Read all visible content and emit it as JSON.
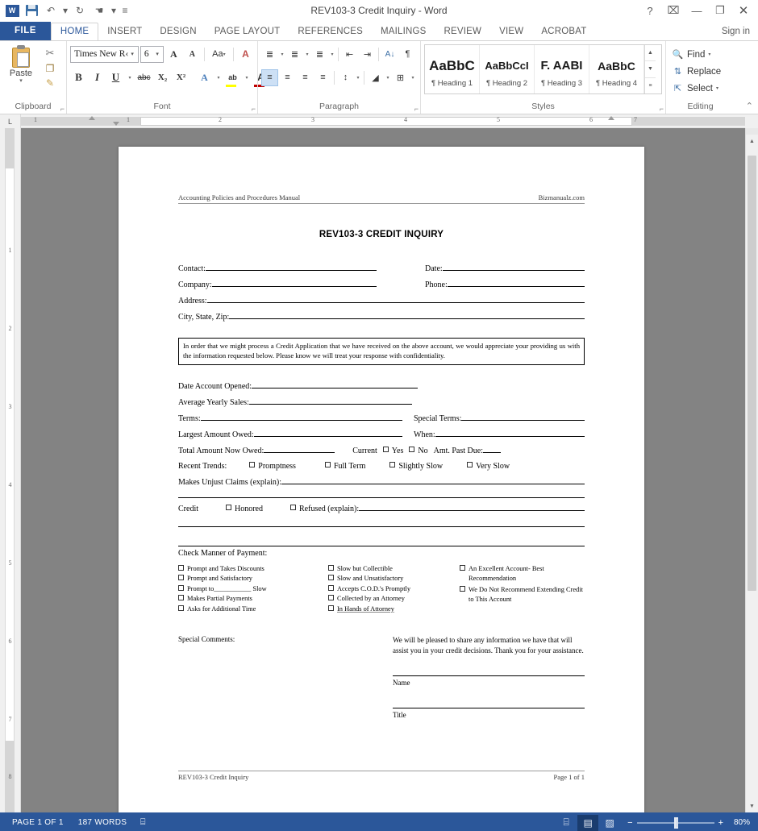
{
  "window": {
    "title": "REV103-3 Credit Inquiry - Word",
    "quick_access": [
      {
        "name": "word-logo",
        "label": "W"
      },
      {
        "name": "save",
        "label": "Save"
      },
      {
        "name": "undo",
        "label": "↶"
      },
      {
        "name": "undo-dropdown",
        "label": "▾"
      },
      {
        "name": "repeat",
        "label": "↻"
      },
      {
        "name": "touch-mode",
        "label": "☚"
      },
      {
        "name": "touch-dropdown",
        "label": "▾"
      },
      {
        "name": "customize-qat",
        "label": "≡"
      }
    ],
    "controls": {
      "help": "?",
      "ribbon_display": "⌧",
      "minimize": "—",
      "maximize": "❐",
      "close": "✕"
    }
  },
  "tabs": [
    {
      "label": "FILE",
      "active": false,
      "file": true
    },
    {
      "label": "HOME",
      "active": true,
      "file": false
    },
    {
      "label": "INSERT",
      "active": false,
      "file": false
    },
    {
      "label": "DESIGN",
      "active": false,
      "file": false
    },
    {
      "label": "PAGE LAYOUT",
      "active": false,
      "file": false
    },
    {
      "label": "REFERENCES",
      "active": false,
      "file": false
    },
    {
      "label": "MAILINGS",
      "active": false,
      "file": false
    },
    {
      "label": "REVIEW",
      "active": false,
      "file": false
    },
    {
      "label": "VIEW",
      "active": false,
      "file": false
    },
    {
      "label": "ACROBAT",
      "active": false,
      "file": false
    }
  ],
  "sign_in": "Sign in",
  "ribbon": {
    "clipboard": {
      "label": "Clipboard",
      "paste_label": "Paste",
      "paste_caret": "▾",
      "cut": "✂",
      "copy": "❐",
      "format_painter": "✎",
      "dialog_launcher": "⌐"
    },
    "font": {
      "label": "Font",
      "font_name": "Times New R‹",
      "font_size": "6",
      "grow_font": "A",
      "shrink_font": "A",
      "change_case": "Aa",
      "clear_formatting": "A",
      "bold": "B",
      "italic": "I",
      "underline": "U",
      "strikethrough": "abc",
      "subscript": "X₂",
      "superscript": "X²",
      "text_effects": "A",
      "highlight": "ab",
      "font_color": "A",
      "caret": "▾",
      "dialog_launcher": "⌐"
    },
    "paragraph": {
      "label": "Paragraph",
      "bullets": "≣",
      "numbering": "≣",
      "multilevel": "≣",
      "decrease_indent": "⇤",
      "increase_indent": "⇥",
      "sort": "A↓",
      "show_marks": "¶",
      "align_left": "≡",
      "align_center": "≡",
      "align_right": "≡",
      "justify": "≡",
      "line_spacing": "↕",
      "shading": "◢",
      "borders": "⊞",
      "caret": "▾",
      "dialog_launcher": "⌐"
    },
    "styles": {
      "label": "Styles",
      "items": [
        {
          "preview": "AaBbC",
          "name": "Heading 1"
        },
        {
          "preview": "AaBbCcI",
          "name": "Heading 2"
        },
        {
          "preview": "F. AABI",
          "name": "Heading 3"
        },
        {
          "preview": "AaBbC",
          "name": "Heading 4"
        }
      ],
      "scroll_up": "▲",
      "scroll_down": "▼",
      "more": "≡",
      "dialog_launcher": "⌐"
    },
    "editing": {
      "label": "Editing",
      "find": "Find",
      "replace": "Replace",
      "select": "Select",
      "caret": "▾"
    },
    "collapse_ribbon": "⌃"
  },
  "ruler": {
    "corner_marker": "L",
    "h_numbers": [
      "1",
      "1",
      "2",
      "3",
      "4",
      "5",
      "6",
      "7"
    ],
    "v_numbers": [
      "1",
      "2",
      "3",
      "4",
      "5",
      "6",
      "7",
      "8"
    ]
  },
  "document": {
    "header": {
      "left": "Accounting Policies and Procedures Manual",
      "right": "Bizmanualz.com"
    },
    "title": "REV103-3 CREDIT INQUIRY",
    "contact_fields": [
      {
        "left_label": "Contact:",
        "right_label": "Date:"
      },
      {
        "left_label": "Company:",
        "right_label": "Phone:"
      },
      {
        "left_label": "Address:",
        "right_label": ""
      },
      {
        "left_label": "City, State, Zip:",
        "right_label": ""
      }
    ],
    "notice": "In order that we might process a Credit Application that we have received on the above account, we would appreciate your providing us with the information requested below.  Please know we will treat your response with confidentiality.",
    "account_fields": [
      {
        "label": "Date Account Opened:",
        "line_width": 206
      },
      {
        "label": "Average Yearly Sales:",
        "line_width": 206
      }
    ],
    "terms_row": {
      "left_label": "Terms:",
      "right_label": "Special Terms:"
    },
    "owed_row": {
      "left_label": "Largest Amount Owed:",
      "right_label": "When:"
    },
    "total_row": {
      "label": "Total Amount Now Owed:",
      "current_label": "Current",
      "yes_label": "Yes",
      "no_label": "No",
      "past_due_label": "Amt. Past Due:"
    },
    "trends": {
      "label": "Recent Trends:",
      "options": [
        "Promptness",
        "Full Term",
        "Slightly Slow",
        "Very Slow"
      ]
    },
    "unjust_claims_label": "Makes Unjust Claims (explain):",
    "credit_row": {
      "label": "Credit",
      "honored": "Honored",
      "refused": "Refused (explain):"
    },
    "payment_heading": "Check Manner of Payment:",
    "payment_col1": [
      "Prompt and Takes Discounts",
      "Prompt and Satisfactory",
      "Prompt to___________ Slow",
      "Makes Partial Payments",
      "Asks for Additional Time"
    ],
    "payment_col2": [
      "Slow but Collectible",
      "Slow and Unsatisfactory",
      "Accepts C.O.D.'s Promptly",
      "Collected by an Attorney",
      "In Hands of Attorney"
    ],
    "payment_col3": [
      "An Excellent Account- Best Recommendation",
      "We Do Not Recommend Extending Credit to This Account"
    ],
    "special_comments_label": "Special Comments:",
    "closing_text": "We will be pleased to share any information we have that will assist you in your credit decisions.  Thank you for your assistance.",
    "signature_name_label": "Name",
    "signature_title_label": "Title",
    "footer": {
      "left": "REV103-3 Credit Inquiry",
      "right": "Page 1 of 1"
    }
  },
  "status_bar": {
    "page_indicator": "PAGE 1 OF 1",
    "word_count": "187 WORDS",
    "proofing_icon": "⌸",
    "views": [
      {
        "name": "read-mode",
        "glyph": "⌸",
        "active": false
      },
      {
        "name": "print-layout",
        "glyph": "▤",
        "active": true
      },
      {
        "name": "web-layout",
        "glyph": "▨",
        "active": false
      }
    ],
    "zoom_out": "−",
    "zoom_in": "+",
    "zoom_level": "80%"
  }
}
